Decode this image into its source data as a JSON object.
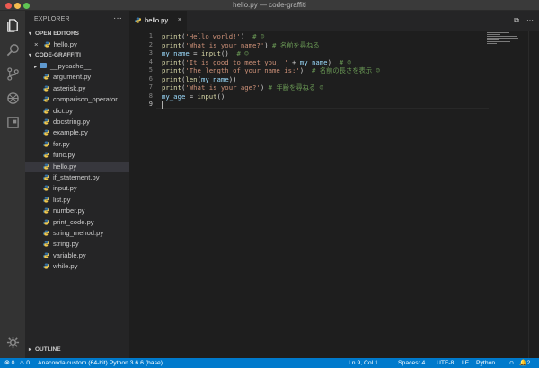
{
  "window": {
    "title": "hello.py — code-graffiti"
  },
  "activity_bar": [
    "files-icon",
    "search-icon",
    "source-control-icon",
    "debug-icon",
    "extensions-icon",
    "settings-gear-icon"
  ],
  "sidebar": {
    "title": "EXPLORER",
    "more": "···",
    "open_editors_header": "OPEN EDITORS",
    "open_editors": [
      {
        "name": "hello.py",
        "close": "×"
      }
    ],
    "folder_header": "CODE-GRAFFITI",
    "files": [
      {
        "name": "__pycache__",
        "kind": "folder"
      },
      {
        "name": "argument.py",
        "kind": "py"
      },
      {
        "name": "asterisk.py",
        "kind": "py"
      },
      {
        "name": "comparison_operator.…",
        "kind": "py"
      },
      {
        "name": "dict.py",
        "kind": "py"
      },
      {
        "name": "docstring.py",
        "kind": "py"
      },
      {
        "name": "example.py",
        "kind": "py"
      },
      {
        "name": "for.py",
        "kind": "py"
      },
      {
        "name": "func.py",
        "kind": "py"
      },
      {
        "name": "hello.py",
        "kind": "py",
        "selected": true
      },
      {
        "name": "if_statement.py",
        "kind": "py"
      },
      {
        "name": "input.py",
        "kind": "py"
      },
      {
        "name": "list.py",
        "kind": "py"
      },
      {
        "name": "number.py",
        "kind": "py"
      },
      {
        "name": "print_code.py",
        "kind": "py"
      },
      {
        "name": "string_mehod.py",
        "kind": "py"
      },
      {
        "name": "string.py",
        "kind": "py"
      },
      {
        "name": "variable.py",
        "kind": "py"
      },
      {
        "name": "while.py",
        "kind": "py"
      }
    ],
    "outline_header": "OUTLINE"
  },
  "tabs": [
    {
      "label": "hello.py",
      "close": "×"
    }
  ],
  "tab_actions": [
    "⧉",
    "···"
  ],
  "editor": {
    "lines": [
      [
        [
          "fn",
          "print"
        ],
        [
          "op",
          "("
        ],
        [
          "str",
          "'Hello world!'"
        ],
        [
          "op",
          ")  "
        ],
        [
          "cm",
          "# ☺"
        ]
      ],
      [
        [
          "fn",
          "print"
        ],
        [
          "op",
          "("
        ],
        [
          "str",
          "'What is your name?'"
        ],
        [
          "op",
          ") "
        ],
        [
          "cm",
          "# 名前を尋ねる"
        ]
      ],
      [
        [
          "var",
          "my_name"
        ],
        [
          "op",
          " = "
        ],
        [
          "fn",
          "input"
        ],
        [
          "op",
          "()  "
        ],
        [
          "cm",
          "# ☺"
        ]
      ],
      [
        [
          "fn",
          "print"
        ],
        [
          "op",
          "("
        ],
        [
          "str",
          "'It is good to meet you, '"
        ],
        [
          "op",
          " + "
        ],
        [
          "var",
          "my_name"
        ],
        [
          "op",
          ")  "
        ],
        [
          "cm",
          "# ☺"
        ]
      ],
      [
        [
          "fn",
          "print"
        ],
        [
          "op",
          "("
        ],
        [
          "str",
          "'The length of your name is:'"
        ],
        [
          "op",
          ")  "
        ],
        [
          "cm",
          "# 名前の長さを表示 ☺"
        ]
      ],
      [
        [
          "fn",
          "print"
        ],
        [
          "op",
          "("
        ],
        [
          "fn",
          "len"
        ],
        [
          "op",
          "("
        ],
        [
          "var",
          "my_name"
        ],
        [
          "op",
          "))"
        ]
      ],
      [
        [
          "fn",
          "print"
        ],
        [
          "op",
          "("
        ],
        [
          "str",
          "'What is your age?'"
        ],
        [
          "op",
          ") "
        ],
        [
          "cm",
          "# 年齢を尋ねる ☺"
        ]
      ],
      [
        [
          "var",
          "my_age"
        ],
        [
          "op",
          " = "
        ],
        [
          "fn",
          "input"
        ],
        [
          "op",
          "()"
        ]
      ],
      []
    ],
    "line_numbers": [
      "1",
      "2",
      "3",
      "4",
      "5",
      "6",
      "7",
      "8",
      "9"
    ],
    "active_line": 9
  },
  "statusbar": {
    "errors": "0",
    "warnings": "0",
    "interpreter": "Anaconda custom (64-bit) Python 3.6.6 (base)",
    "position": "Ln 9, Col 1",
    "spaces": "Spaces: 4",
    "encoding": "UTF-8",
    "eol": "LF",
    "language": "Python",
    "notifications": "2"
  },
  "colors": {
    "statusbar": "#007acc",
    "activitybar": "#333333",
    "sidebar": "#252526",
    "editor": "#1e1e1e"
  }
}
